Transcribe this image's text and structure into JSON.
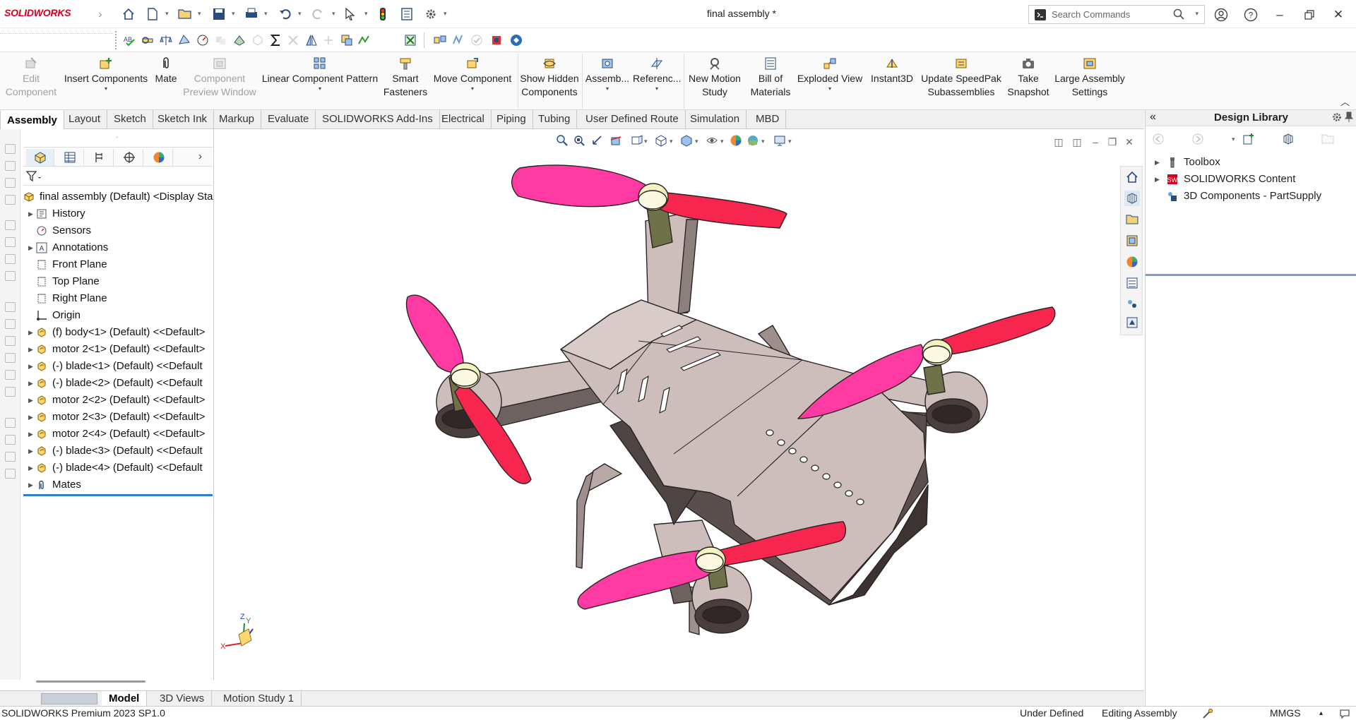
{
  "app": {
    "logo": "SOLIDWORKS",
    "doc_title": "final assembly *"
  },
  "search": {
    "placeholder": "Search Commands"
  },
  "ribbon": {
    "items": [
      {
        "label": "Edit\nComponent",
        "disabled": true
      },
      {
        "label": "Insert Components",
        "disabled": false
      },
      {
        "label": "Mate",
        "disabled": false
      },
      {
        "label": "Component\nPreview Window",
        "disabled": true
      },
      {
        "label": "Linear Component Pattern",
        "disabled": false
      },
      {
        "label": "Smart\nFasteners",
        "disabled": false
      },
      {
        "label": "Move Component",
        "disabled": false
      },
      {
        "label": "Show Hidden\nComponents",
        "disabled": false
      },
      {
        "label": "Assemb...",
        "disabled": false
      },
      {
        "label": "Referenc...",
        "disabled": false
      },
      {
        "label": "New Motion\nStudy",
        "disabled": false
      },
      {
        "label": "Bill of\nMaterials",
        "disabled": false
      },
      {
        "label": "Exploded View",
        "disabled": false
      },
      {
        "label": "Instant3D",
        "disabled": false
      },
      {
        "label": "Update SpeedPak\nSubassemblies",
        "disabled": false
      },
      {
        "label": "Take\nSnapshot",
        "disabled": false
      },
      {
        "label": "Large Assembly\nSettings",
        "disabled": false
      }
    ]
  },
  "tabs": [
    "Assembly",
    "Layout",
    "Sketch",
    "Sketch Ink",
    "Markup",
    "Evaluate",
    "SOLIDWORKS Add-Ins",
    "Electrical",
    "Piping",
    "Tubing",
    "User Defined Route",
    "Simulation",
    "MBD"
  ],
  "tree": {
    "root": "final assembly (Default) <Display Sta",
    "items": [
      {
        "label": "History",
        "icon": "history-icon",
        "arrow": true
      },
      {
        "label": "Sensors",
        "icon": "sensors-icon",
        "arrow": false
      },
      {
        "label": "Annotations",
        "icon": "annotations-icon",
        "arrow": true
      },
      {
        "label": "Front Plane",
        "icon": "plane-icon",
        "arrow": false
      },
      {
        "label": "Top Plane",
        "icon": "plane-icon",
        "arrow": false
      },
      {
        "label": "Right Plane",
        "icon": "plane-icon",
        "arrow": false
      },
      {
        "label": "Origin",
        "icon": "origin-icon",
        "arrow": false
      },
      {
        "label": "(f) body<1> (Default) <<Default>",
        "icon": "part-icon",
        "arrow": true
      },
      {
        "label": "motor 2<1> (Default) <<Default>",
        "icon": "part-icon",
        "arrow": true
      },
      {
        "label": "(-) blade<1> (Default) <<Default",
        "icon": "part-icon",
        "arrow": true
      },
      {
        "label": "(-) blade<2> (Default) <<Default",
        "icon": "part-icon",
        "arrow": true
      },
      {
        "label": "motor 2<2> (Default) <<Default>",
        "icon": "part-icon",
        "arrow": true
      },
      {
        "label": "motor 2<3> (Default) <<Default>",
        "icon": "part-icon",
        "arrow": true
      },
      {
        "label": "motor 2<4> (Default) <<Default>",
        "icon": "part-icon",
        "arrow": true
      },
      {
        "label": "(-) blade<3> (Default) <<Default",
        "icon": "part-icon",
        "arrow": true
      },
      {
        "label": "(-) blade<4> (Default) <<Default",
        "icon": "part-icon",
        "arrow": true
      },
      {
        "label": "Mates",
        "icon": "mates-icon",
        "arrow": true
      }
    ]
  },
  "bottom_tabs": [
    "Model",
    "3D Views",
    "Motion Study 1"
  ],
  "status": {
    "product": "SOLIDWORKS Premium 2023 SP1.0",
    "state": "Under Defined",
    "mode": "Editing Assembly",
    "units": "MMGS"
  },
  "design_library": {
    "title": "Design Library",
    "items": [
      {
        "label": "Toolbox",
        "icon": "toolbox-icon",
        "arrow": true
      },
      {
        "label": "SOLIDWORKS Content",
        "icon": "sw-content-icon",
        "arrow": true
      },
      {
        "label": "3D Components - PartSupply",
        "icon": "partsupply-icon",
        "arrow": false
      }
    ]
  },
  "axes": {
    "x": "X",
    "y": "Y",
    "z": "Z"
  },
  "colors": {
    "brand": "#d4001e",
    "blade_pink": "#ff3aa3",
    "blade_red": "#f7264f",
    "body": "#cdbebb",
    "accent_blue": "#2f7fd0"
  }
}
